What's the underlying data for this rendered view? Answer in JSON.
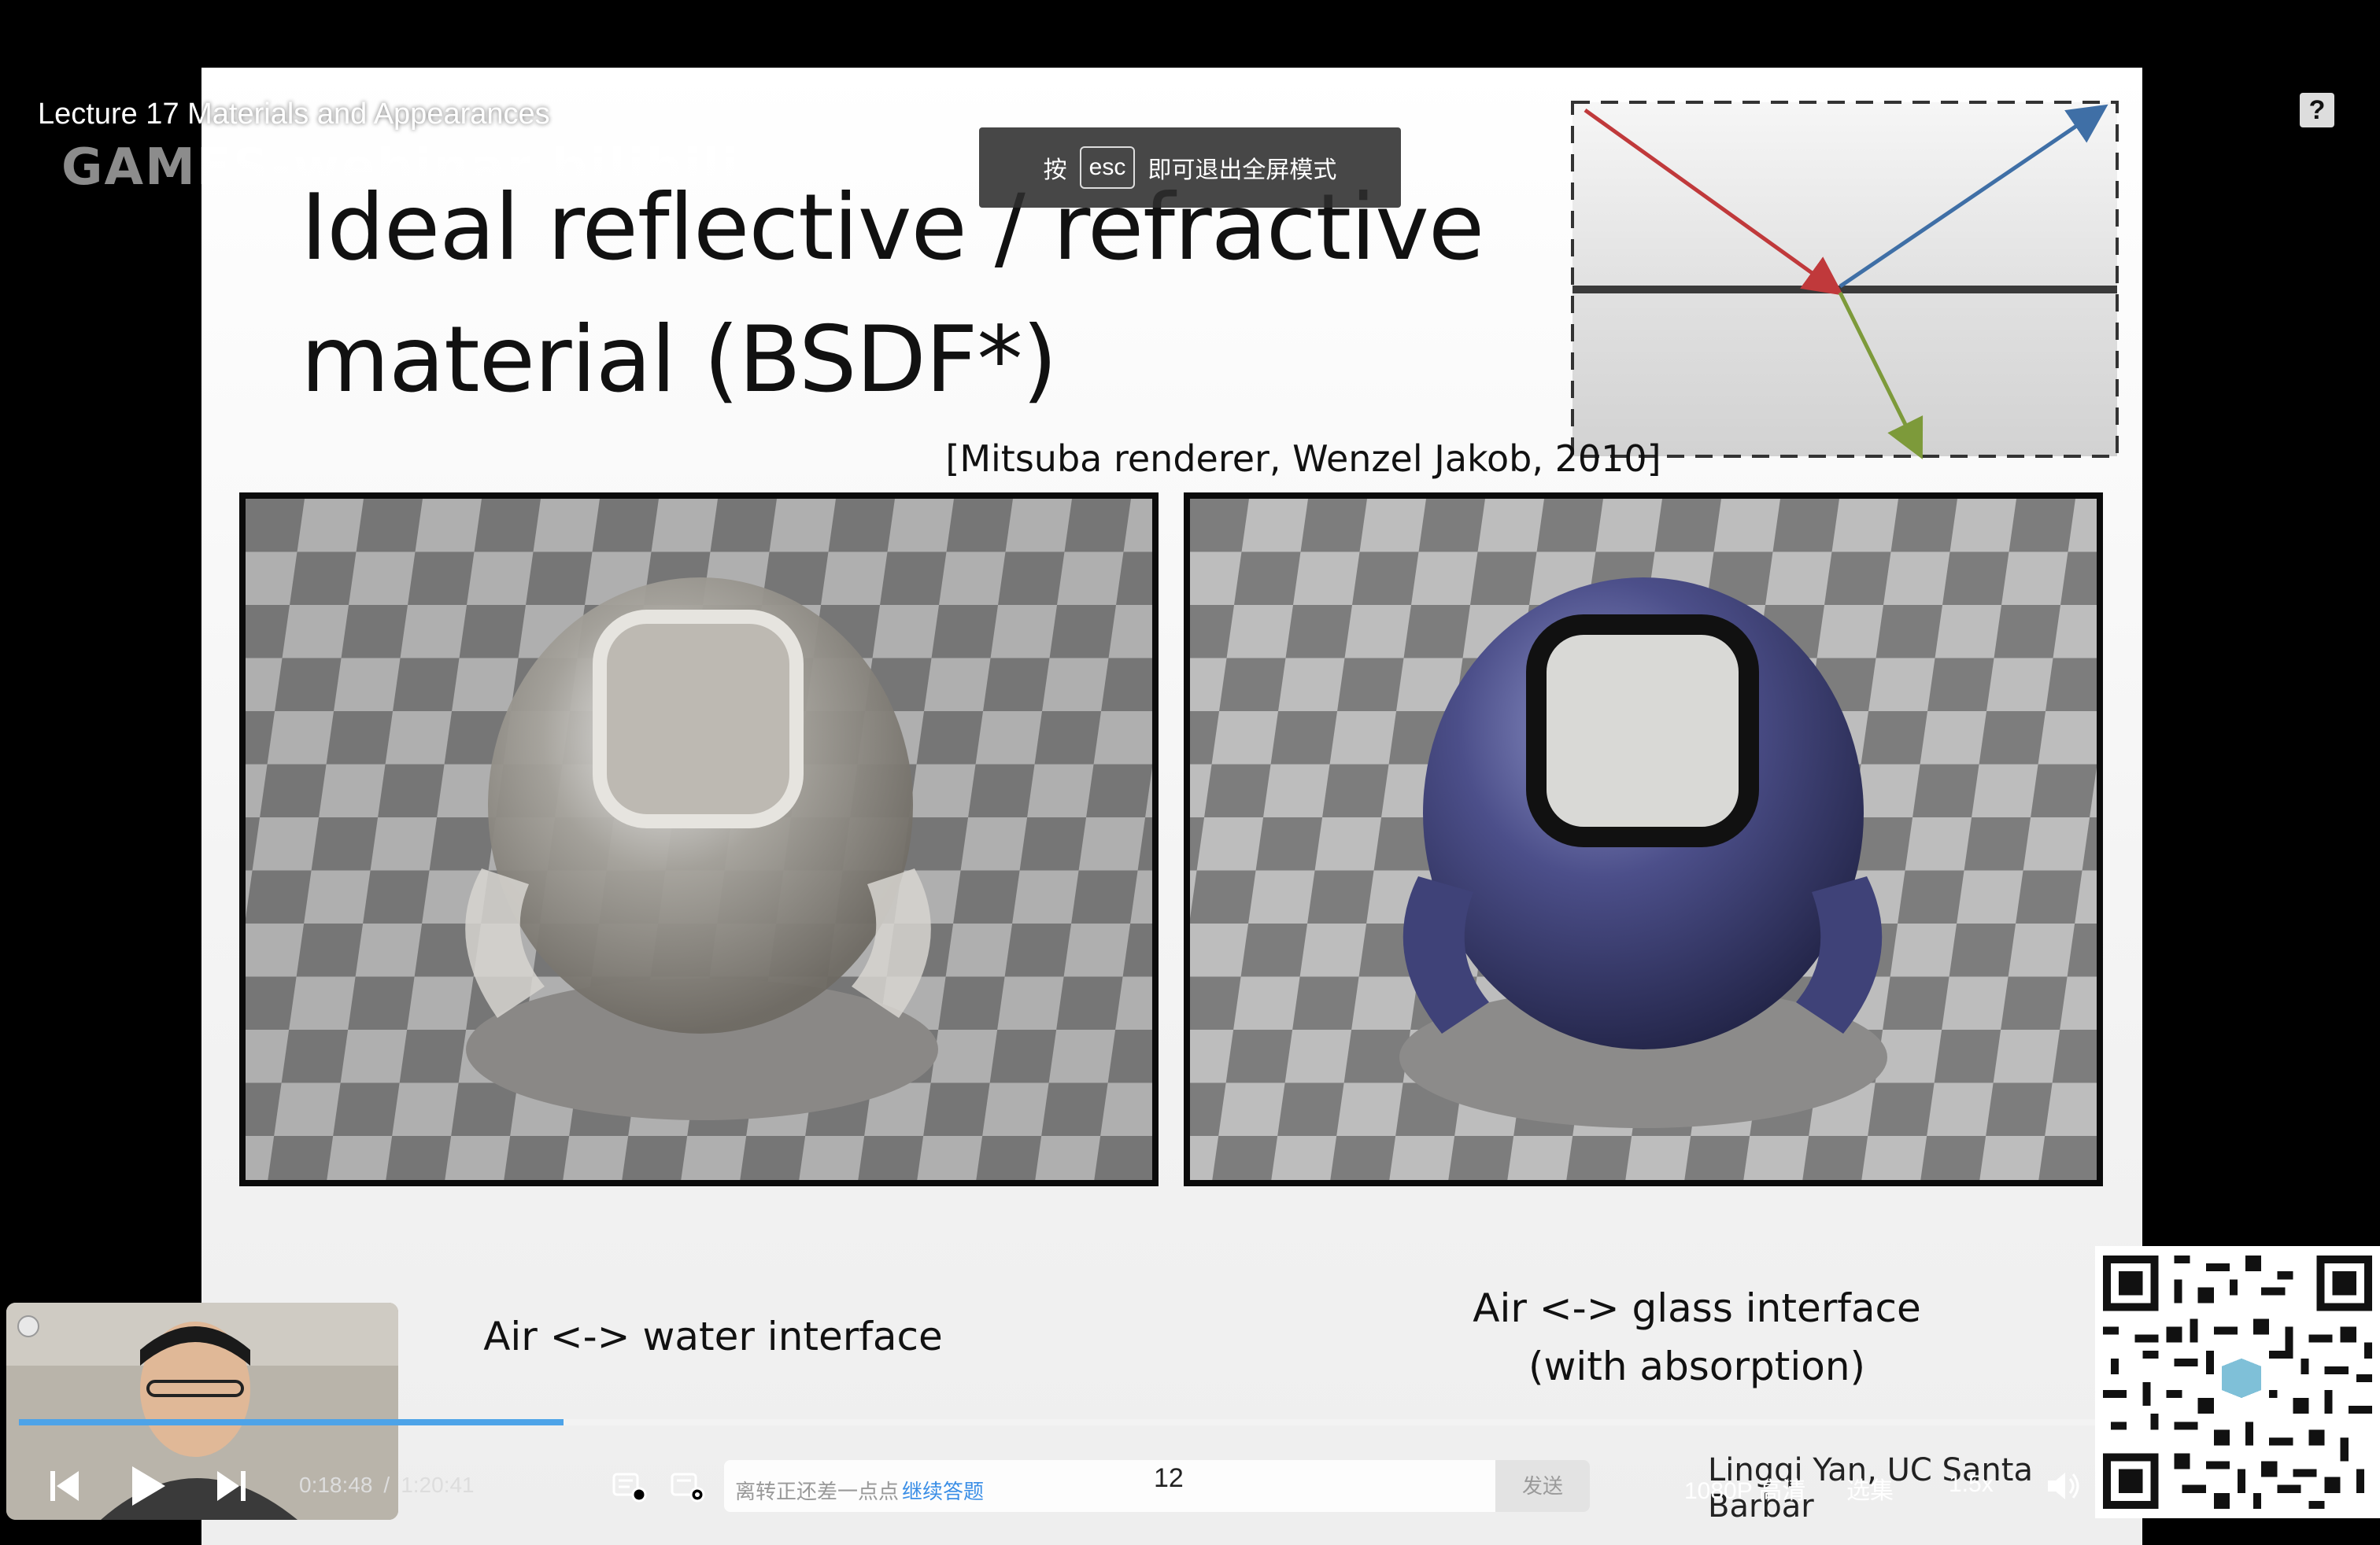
{
  "video": {
    "title": "Lecture 17 Materials and Appearances",
    "watermark": "GAMES-webinar bilibili"
  },
  "esc_tip": {
    "prefix": "按",
    "key": "esc",
    "suffix": "即可退出全屏模式"
  },
  "slide": {
    "title_line1": "Ideal reflective / refractive",
    "title_line2": "material (BSDF*)",
    "citation": "[Mitsuba renderer, Wenzel Jakob, 2010]",
    "caption_left": "Air <-> water interface",
    "caption_right_line1": "Air <-> glass interface",
    "caption_right_line2": "(with absorption)",
    "credit": "Lingqi Yan, UC Santa Barbar",
    "diagram_colors": {
      "incident": "#c0393b",
      "reflected": "#3f6fa6",
      "refracted": "#7d9a3a",
      "interface": "#333333"
    }
  },
  "player": {
    "current_time": "0:18:48",
    "time_separator": "/",
    "duration": "1:20:41",
    "progress": 0.233,
    "danmaku_hint": "离转正还差一点点",
    "danmaku_link": "继续答题",
    "danmaku_count": "12",
    "send_label": "发送",
    "quality": "1080P 高清",
    "episodes": "选集",
    "speed": "1.5x",
    "accent_color": "#4da3e8"
  },
  "icons": {
    "help": "help-icon",
    "prev": "skip-previous-icon",
    "play": "play-icon",
    "next": "skip-next-icon",
    "danmaku_toggle": "danmaku-toggle-icon",
    "danmaku_settings": "danmaku-settings-icon",
    "volume": "volume-icon",
    "settings": "settings-icon",
    "pip": "picture-in-picture-icon",
    "fullscreen": "fullscreen-icon"
  }
}
